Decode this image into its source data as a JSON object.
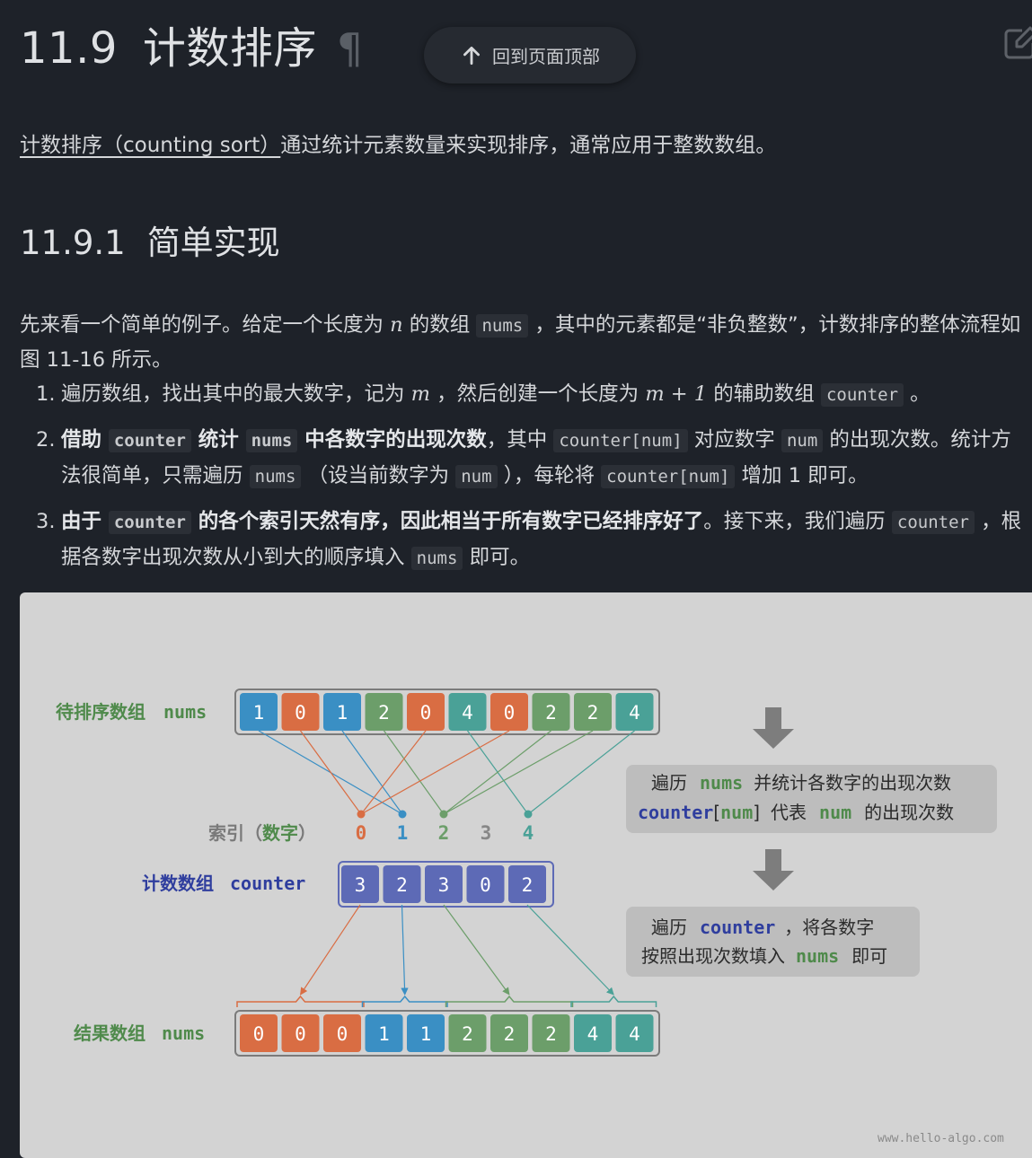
{
  "page": {
    "heading_number": "11.9",
    "heading_text": "计数排序",
    "heading_anchor": "¶",
    "back_to_top_label": "回到页面顶部",
    "edit_icon": "edit-icon",
    "intro_link": "计数排序（counting sort）",
    "intro_rest": "通过统计元素数量来实现排序，通常应用于整数数组。"
  },
  "section": {
    "number": "11.9.1",
    "title": "简单实现",
    "para": {
      "p1": "先来看一个简单的例子。给定一个长度为 ",
      "var_n": "n",
      "p2": " 的数组 ",
      "code_nums": "nums",
      "p3": " ，其中的元素都是“非负整数”，计数排序的整体流程如图 11-16 所示。"
    }
  },
  "steps": [
    {
      "marker": "1.",
      "t1": "遍历数组，找出其中的最大数字，记为 ",
      "v1": "m",
      "t2": " ，然后创建一个长度为 ",
      "v2": "m + 1",
      "t3": " 的辅助数组 ",
      "c1": "counter",
      "t4": " 。"
    },
    {
      "marker": "2.",
      "b1": "借助 ",
      "bc1": "counter",
      "b2": " 统计 ",
      "bc2": "nums",
      "b3": " 中各数字的出现次数",
      "t1": "，其中 ",
      "c1": "counter[num]",
      "t2": " 对应数字 ",
      "c2": "num",
      "t3": " 的出现次数。统计方法很简单，只需遍历 ",
      "c3": "nums",
      "t4": " （设当前数字为 ",
      "c4": "num",
      "t5": " ），每轮将 ",
      "c5": "counter[num]",
      "t6": " 增加 1 即可。"
    },
    {
      "marker": "3.",
      "b1": "由于 ",
      "bc1": "counter",
      "b2": " 的各个索引天然有序，因此相当于所有数字已经排序好了",
      "t1": "。接下来，我们遍历 ",
      "c1": "counter",
      "t2": " ，根据各数字出现次数从小到大的顺序填入 ",
      "c2": "nums",
      "t3": " 即可。"
    }
  ],
  "figure": {
    "input_label_cn": "待排序数组",
    "input_label_code": "nums",
    "index_label": "索引（",
    "index_label_mid": "数字",
    "index_label_end": "）",
    "counter_label_cn": "计数数组",
    "counter_label_code": "counter",
    "result_label_cn": "结果数组",
    "result_label_code": "nums",
    "note1_a": "遍历",
    "note1_b": "nums",
    "note1_c": "并统计各数字的出现次数",
    "note1_d": "counter",
    "note1_e": "[",
    "note1_f": "num",
    "note1_g": "]",
    "note1_h": "代表",
    "note1_i": "num",
    "note1_j": "的出现次数",
    "note2_a": "遍历",
    "note2_b": "counter",
    "note2_c": "，将各数字",
    "note2_d": "按照出现次数填入",
    "note2_e": "nums",
    "note2_f": "即可",
    "watermark": "www.hello-algo.com",
    "colors": {
      "0": "#d96d43",
      "1": "#3a8fc4",
      "2": "#6c9e6a",
      "3": "#878787",
      "4": "#4aa197",
      "counter_box": "#5d6ab6",
      "label_green": "#4f8a4b",
      "label_blue": "#2f3e9e",
      "arrow_gray": "#7d7d7d"
    },
    "input_array": [
      "1",
      "0",
      "1",
      "2",
      "0",
      "4",
      "0",
      "2",
      "2",
      "4"
    ],
    "index_digits": [
      "0",
      "1",
      "2",
      "3",
      "4"
    ],
    "counter_array": [
      "3",
      "2",
      "3",
      "0",
      "2"
    ],
    "result_array": [
      "0",
      "0",
      "0",
      "1",
      "1",
      "2",
      "2",
      "2",
      "4",
      "4"
    ]
  }
}
